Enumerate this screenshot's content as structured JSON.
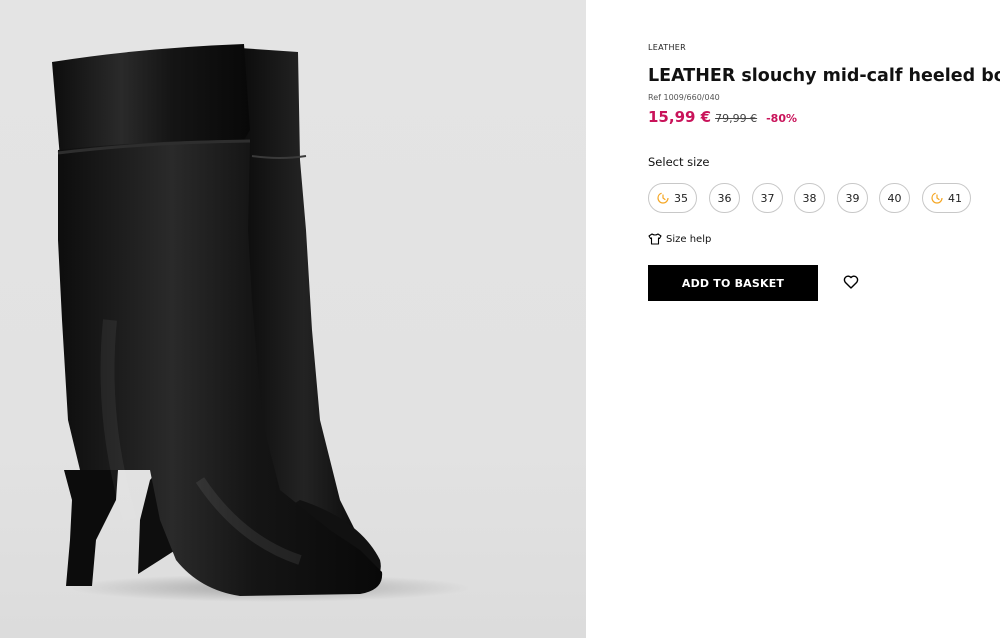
{
  "product": {
    "category": "LEATHER",
    "title": "LEATHER slouchy mid-calf heeled boots",
    "ref": "Ref 1009/660/040",
    "price": "15,99 €",
    "old_price": "79,99 €",
    "discount": "-80%"
  },
  "size_selector": {
    "label": "Select size",
    "sizes": [
      {
        "label": "35",
        "low_stock": true
      },
      {
        "label": "36",
        "low_stock": false
      },
      {
        "label": "37",
        "low_stock": false
      },
      {
        "label": "38",
        "low_stock": false
      },
      {
        "label": "39",
        "low_stock": false
      },
      {
        "label": "40",
        "low_stock": false
      },
      {
        "label": "41",
        "low_stock": true
      }
    ]
  },
  "size_help": {
    "label": "Size help",
    "icon": "hanger-icon"
  },
  "actions": {
    "add_to_basket": "ADD TO BASKET",
    "wishlist_icon": "heart-icon"
  },
  "colors": {
    "price": "#c9135a",
    "clock_icon": "#f5a623",
    "button_bg": "#000000"
  }
}
